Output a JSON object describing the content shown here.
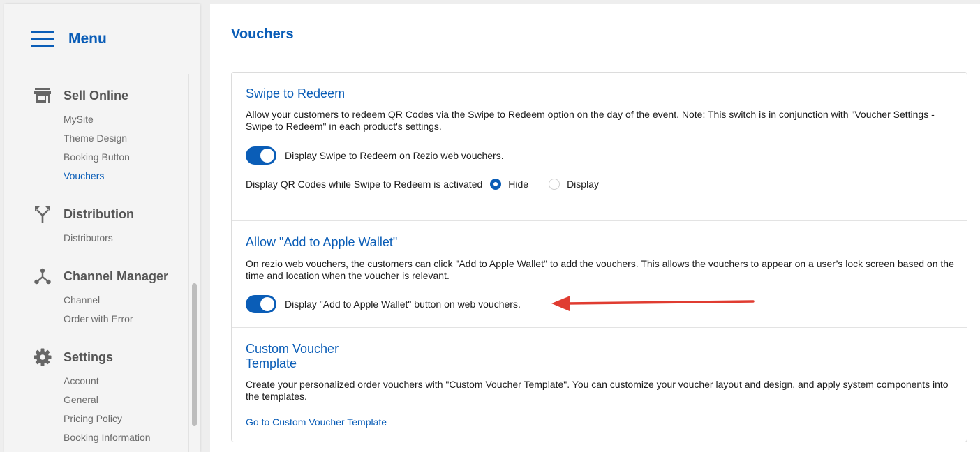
{
  "sidebar": {
    "menu_title": "Menu",
    "sections": [
      {
        "icon": "store-icon",
        "label": "Sell Online",
        "items": [
          "MySite",
          "Theme Design",
          "Booking Button",
          "Vouchers"
        ]
      },
      {
        "icon": "split-arrows-icon",
        "label": "Distribution",
        "items": [
          "Distributors"
        ]
      },
      {
        "icon": "hub-icon",
        "label": "Channel Manager",
        "items": [
          "Channel",
          "Order with Error"
        ]
      },
      {
        "icon": "gear-icon",
        "label": "Settings",
        "items": [
          "Account",
          "General",
          "Pricing Policy",
          "Booking Information"
        ]
      }
    ],
    "active_item": "Vouchers"
  },
  "main": {
    "page_title": "Vouchers",
    "swipe": {
      "title": "Swipe to Redeem",
      "description": "Allow your customers to redeem QR Codes via the Swipe to Redeem option on the day of the event. Note: This switch is in conjunction with \"Voucher Settings - Swipe to Redeem\" in each product's settings.",
      "toggle_label": "Display Swipe to Redeem on Rezio web vouchers.",
      "toggle_on": true,
      "qr_question": "Display QR Codes while Swipe to Redeem is activated",
      "qr_options": [
        "Hide",
        "Display"
      ],
      "qr_selected": "Hide"
    },
    "wallet": {
      "title": "Allow \"Add to Apple Wallet\"",
      "description": "On rezio web vouchers, the customers can click \"Add to Apple Wallet\" to add the vouchers. This allows the vouchers to appear on a user’s lock screen based on the time and location when the voucher is relevant.",
      "toggle_label": "Display \"Add to Apple Wallet\" button on web vouchers.",
      "toggle_on": true
    },
    "custom": {
      "title_line1": "Custom Voucher",
      "title_line2": "Template",
      "description": "Create your personalized order vouchers with \"Custom Voucher Template\". You can customize your voucher layout and design, and apply system components into the templates.",
      "link": "Go to Custom Voucher Template"
    }
  },
  "colors": {
    "brand": "#0a5db7",
    "annotation_arrow": "#e03c31"
  }
}
